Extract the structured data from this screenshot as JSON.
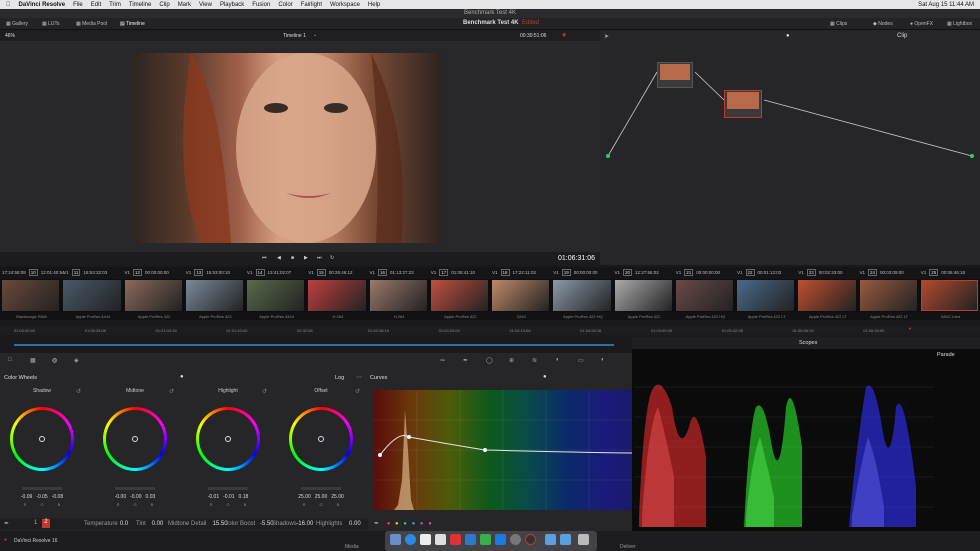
{
  "menubar": {
    "app": "DaVinci Resolve",
    "items": [
      "File",
      "Edit",
      "Trim",
      "Timeline",
      "Clip",
      "Mark",
      "View",
      "Playback",
      "Fusion",
      "Color",
      "Fairlight",
      "Workspace",
      "Help"
    ],
    "status": "Sat Aug 15  11:44 AM"
  },
  "title": {
    "main": "Benchmark Test 4K",
    "project": "Benchmark Test 4K",
    "edited": "Edited"
  },
  "nav": {
    "gallery": "Gallery",
    "luts": "LUTs",
    "media_pool": "Media Pool",
    "timeline": "Timeline",
    "clips": "Clips",
    "nodes": "Nodes",
    "openfx": "OpenFX",
    "lightbox": "Lightbox"
  },
  "viewer": {
    "zoom": "46%",
    "timeline_name": "Timeline 1",
    "timecode": "00:30:51:06",
    "node_mode": "Clip",
    "transport_tc": "01:06:31:06"
  },
  "clips": [
    {
      "tc": "17:24:58:08",
      "num": "10",
      "tcode": "12:01:40:54",
      "label": "Blackmagic RAW"
    },
    {
      "tc": "V1",
      "num": "11",
      "tcode": "18:53:32:03",
      "label": "Apple ProRes 4444"
    },
    {
      "tc": "V1",
      "num": "12",
      "tcode": "00:00:00:00",
      "label": "Apple ProRes 422"
    },
    {
      "tc": "V1",
      "num": "13",
      "tcode": "15:53:00:10",
      "label": "Apple ProRes 422"
    },
    {
      "tc": "V1",
      "num": "14",
      "tcode": "13:41:02:07",
      "label": "Apple ProRes 4444"
    },
    {
      "tc": "V1",
      "num": "15",
      "tcode": "00:25:46:12",
      "label": "H.264"
    },
    {
      "tc": "V1",
      "num": "16",
      "tcode": "01:13:27:23",
      "label": "H.264"
    },
    {
      "tc": "V1",
      "num": "17",
      "tcode": "01:05:41:10",
      "label": "Apple ProRes 422"
    },
    {
      "tc": "V1",
      "num": "18",
      "tcode": "17:22:11:02",
      "label": "DNG"
    },
    {
      "tc": "V1",
      "num": "19",
      "tcode": "00:00:00:00",
      "label": "Apple ProRes 422 HQ"
    },
    {
      "tc": "V1",
      "num": "20",
      "tcode": "12:27:55:02",
      "label": "Apple ProRes 422"
    },
    {
      "tc": "V1",
      "num": "21",
      "tcode": "00:00:00:00",
      "label": "Apple ProRes 422 HQ"
    },
    {
      "tc": "V1",
      "num": "22",
      "tcode": "00:01:13:03",
      "label": "Apple ProRes 422 LT"
    },
    {
      "tc": "V1",
      "num": "23",
      "tcode": "00:02:33:00",
      "label": "Apple ProRes 422 LT"
    },
    {
      "tc": "V1",
      "num": "24",
      "tcode": "00:03:09:00",
      "label": "Apple ProRes 422 LT"
    },
    {
      "tc": "V1",
      "num": "25",
      "tcode": "00:06:46:18",
      "label": "XAVC Intra"
    }
  ],
  "ruler": [
    "01:00:00:00",
    "01:05:33:08",
    "01:21:00:16",
    "01:21:40:00",
    "01:32:08",
    "01:52:08:16",
    "01:03:20:00",
    "01:03:13:08",
    "01:04:26:16",
    "01:04:00:00",
    "01:05:32:08",
    "01:06:06:16",
    "01:06:40:00"
  ],
  "colorwheels": {
    "title": "Color Wheels",
    "mode": "Log",
    "wheels": [
      {
        "name": "Shadow",
        "vals": [
          "-0.09",
          "-0.05",
          "-0.08"
        ]
      },
      {
        "name": "Midtone",
        "vals": [
          "-0.00",
          "-0.00",
          "0.03"
        ]
      },
      {
        "name": "Highlight",
        "vals": [
          "-0.01",
          "-0.01",
          "0.18"
        ]
      },
      {
        "name": "Offset",
        "vals": [
          "25.00",
          "25.00",
          "25.00"
        ]
      }
    ],
    "rgb": [
      "R",
      "G",
      "B"
    ]
  },
  "params": [
    {
      "k": "Temperature",
      "v": "0.0"
    },
    {
      "k": "Tint",
      "v": "0.00"
    },
    {
      "k": "Midtone Detail",
      "v": "15.50"
    },
    {
      "k": "Color Boost",
      "v": "-5.50"
    },
    {
      "k": "Shadows",
      "v": "-16.00"
    },
    {
      "k": "Highlights",
      "v": "0.00"
    }
  ],
  "curves": {
    "title": "Curves"
  },
  "scopes": {
    "title": "Scopes",
    "mode": "Parade"
  },
  "bottom": {
    "app": "DaVinci Resolve 16",
    "media": "Media",
    "deliver": "Deliver"
  },
  "colors": {
    "accent": "#c0392b",
    "bg": "#1a1a1c"
  }
}
